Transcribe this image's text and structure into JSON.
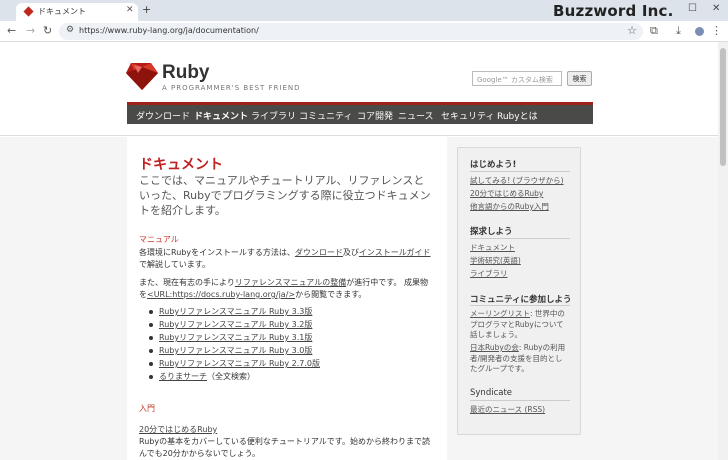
{
  "browser": {
    "tab_title": "ドキュメント",
    "url": "https://www.ruby-lang.org/ja/documentation/",
    "watermark": "Buzzword Inc."
  },
  "header": {
    "title": "Ruby",
    "tagline": "A PROGRAMMER'S BEST FRIEND",
    "search_placeholder": "Google™ カスタム検索",
    "search_button": "検索"
  },
  "menu": [
    "ダウンロード",
    "ドキュメント",
    "ライブラリ",
    "コミュニティ",
    "コア開発",
    "ニュース",
    "セキュリティ",
    "Rubyとは"
  ],
  "menu_active_index": 1,
  "content": {
    "h1": "ドキュメント",
    "lead": "ここでは、マニュアルやチュートリアル、リファレンスといった、Rubyでプログラミングする際に役立つドキュメントを紹介します。",
    "manual_heading": "マニュアル",
    "install_p1": "各環境にRubyをインストールする方法は、",
    "install_link1": "ダウンロード",
    "install_p2": "及び",
    "install_link2": "インストールガイド",
    "install_p3": "で解説しています。",
    "ref_p1": "また、現在有志の手により",
    "ref_link": "リファレンスマニュアルの整備",
    "ref_p2": "が進行中です。 成果物を",
    "ref_url": "<URL:https://docs.ruby-lang.org/ja/>",
    "ref_p3": "から閲覧できます。",
    "ref_items": [
      "Rubyリファレンスマニュアル Ruby 3.3版",
      "Rubyリファレンスマニュアル Ruby 3.2版",
      "Rubyリファレンスマニュアル Ruby 3.1版",
      "Rubyリファレンスマニュアル Ruby 3.0版",
      "Rubyリファレンスマニュアル Ruby 2.7.0版"
    ],
    "rurema_link": "るりまサーチ",
    "rurema_note": "（全文検索）",
    "intro_heading": "入門",
    "intro_link": "20分ではじめるRuby",
    "intro_desc": "Rubyの基本をカバーしている便利なチュートリアルです。始めから終わりまで読んでも20分かからないでしょう。"
  },
  "sidebar": {
    "start_heading": "はじめよう!",
    "start_links": [
      "試してみる! (ブラウザから)",
      "20分ではじめるRuby",
      "他言語からのRuby入門"
    ],
    "explore_heading": "探求しよう",
    "explore_links": [
      "ドキュメント",
      "学術研究(英語)",
      "ライブラリ"
    ],
    "community_heading": "コミュニティに参加しよう",
    "ml_link": "メーリングリスト",
    "ml_desc": ": 世界中のプログラマとRubyについて話しましょう。",
    "nihon_link": "日本Rubyの会",
    "nihon_desc": ": Rubyの利用者/開発者の支援を目的としたグループです。",
    "syndicate_heading": "Syndicate",
    "syndicate_link": "最近のニュース (RSS)"
  }
}
